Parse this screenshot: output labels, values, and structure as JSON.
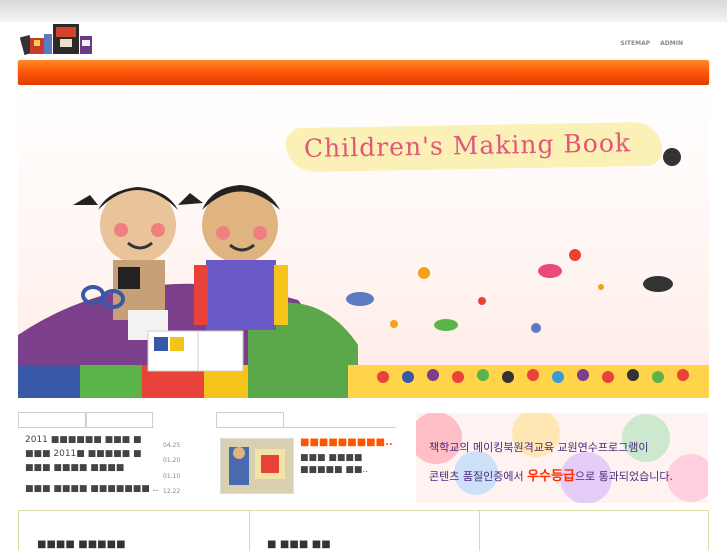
{
  "header": {
    "logo_alt": "book logo",
    "utility_links": [
      "SITEMAP",
      "ADMIN"
    ]
  },
  "hero": {
    "title": "Children's Making Book"
  },
  "notice": {
    "rows": [
      {
        "text": "2011 ■■■■■■ ■■■ ■",
        "date": "04.25"
      },
      {
        "text": "■■■ 2011■ ■■■■■ ■",
        "date": "01.20"
      },
      {
        "text": "■■■ ■■■■ ■■■■",
        "date": "01.10"
      },
      {
        "text": "■■■ ■■■■ ■■■■■■■ ..",
        "date": "12.22"
      }
    ]
  },
  "photo": {
    "title": "■■■■■■■■■..",
    "text": "■■■ ■■■■ ■■■■■ ■■.."
  },
  "banner": {
    "line1": "책학교의 메이킹북원격교육 교원연수프로그램이",
    "line2_pre": "콘텐츠 품질인증에서 ",
    "line2_highlight": "우수등급",
    "line2_post": "으로 통과되었습니다."
  },
  "bottom": {
    "panel1_title": "■■■■ ■■■■■",
    "panel2_title": "■ ■■■ ■■"
  },
  "colors": {
    "nav": "#ff5a0a",
    "banner_text": "#4a2a7a",
    "banner_highlight": "#ff2a00"
  }
}
